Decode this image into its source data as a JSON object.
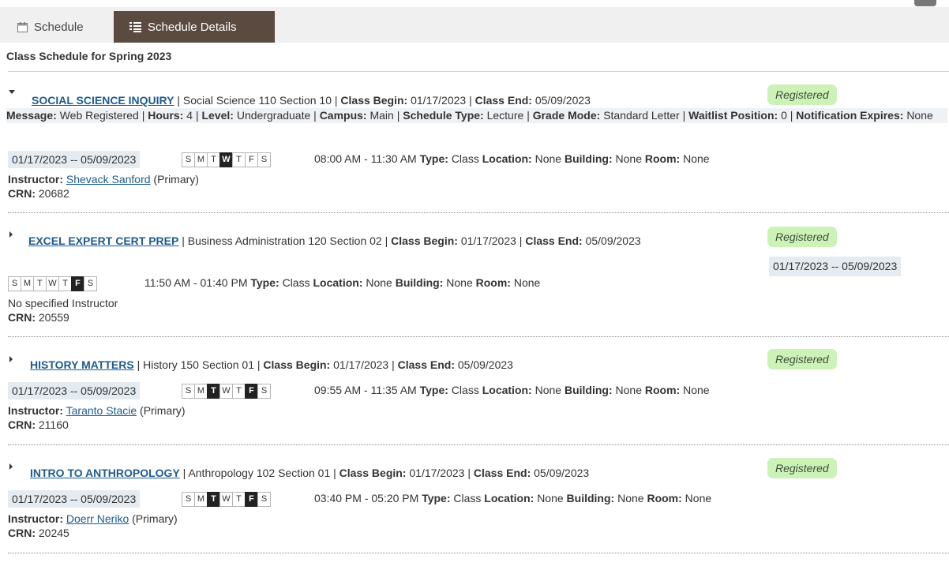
{
  "tabs": {
    "schedule": "Schedule",
    "details": "Schedule Details"
  },
  "page_title": "Class Schedule for Spring 2023",
  "labels": {
    "class_begin": "Class Begin:",
    "class_end": "Class End:",
    "message": "Message:",
    "hours": "Hours:",
    "level": "Level:",
    "campus": "Campus:",
    "schedule_type": "Schedule Type:",
    "grade_mode": "Grade Mode:",
    "waitlist_position": "Waitlist Position:",
    "notification_expires": "Notification Expires:",
    "type": "Type:",
    "location": "Location:",
    "building": "Building:",
    "room": "Room:",
    "instructor": "Instructor:",
    "crn": "CRN:",
    "separator": "|"
  },
  "day_letters": [
    "S",
    "M",
    "T",
    "W",
    "T",
    "F",
    "S"
  ],
  "courses": [
    {
      "title": "SOCIAL SCIENCE INQUIRY",
      "subject": "Social Science 110 Section 10",
      "begin": "01/17/2023",
      "end": "05/09/2023",
      "status": "Registered",
      "details": {
        "message": "Web Registered",
        "hours": "4",
        "level": "Undergraduate",
        "campus": "Main",
        "schedule_type": "Lecture",
        "grade_mode": "Standard Letter",
        "waitlist_position": "0",
        "notification_expires": "None"
      },
      "date_range": "01/17/2023 -- 05/09/2023",
      "days_on": [
        false,
        false,
        false,
        true,
        false,
        false,
        false
      ],
      "time": "08:00 AM - 11:30 AM",
      "type": "Class",
      "location": "None",
      "building": "None",
      "room": "None",
      "instructor": "Shevack Sanford",
      "instructor_role": "(Primary)",
      "crn": "20682"
    },
    {
      "title": "EXCEL EXPERT CERT PREP",
      "subject": "Business Administration 120 Section 02",
      "begin": "01/17/2023",
      "end": "05/09/2023",
      "status": "Registered",
      "date_range": "01/17/2023 -- 05/09/2023",
      "days_on": [
        false,
        false,
        false,
        false,
        false,
        true,
        false
      ],
      "time": "11:50 AM - 01:40 PM",
      "type": "Class",
      "location": "None",
      "building": "None",
      "room": "None",
      "instructor_note": "No specified Instructor",
      "crn": "20559"
    },
    {
      "title": "HISTORY MATTERS",
      "subject": "History 150 Section 01",
      "begin": "01/17/2023",
      "end": "05/09/2023",
      "status": "Registered",
      "date_range": "01/17/2023 -- 05/09/2023",
      "days_on": [
        false,
        false,
        true,
        false,
        false,
        true,
        false
      ],
      "time": "09:55 AM - 11:35 AM",
      "type": "Class",
      "location": "None",
      "building": "None",
      "room": "None",
      "instructor": "Taranto Stacie",
      "instructor_role": "(Primary)",
      "crn": "21160"
    },
    {
      "title": "INTRO TO ANTHROPOLOGY",
      "subject": "Anthropology 102 Section 01",
      "begin": "01/17/2023",
      "end": "05/09/2023",
      "status": "Registered",
      "date_range": "01/17/2023 -- 05/09/2023",
      "days_on": [
        false,
        false,
        true,
        false,
        false,
        true,
        false
      ],
      "time": "03:40 PM - 05:20 PM",
      "type": "Class",
      "location": "None",
      "building": "None",
      "room": "None",
      "instructor": "Doerr Neriko",
      "instructor_role": "(Primary)",
      "crn": "20245"
    }
  ],
  "icons": {
    "schedule_tab": "calendar-icon",
    "details_tab": "list-icon",
    "expand": "caret-icon"
  },
  "colors": {
    "link": "#1e5b8d",
    "registered_badge": "#ccf2b8",
    "active_tab": "#5a4a3f",
    "date_chip": "#e4ebf1"
  }
}
